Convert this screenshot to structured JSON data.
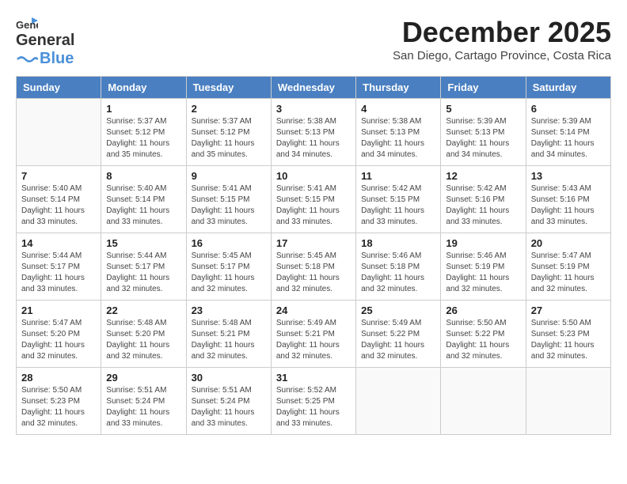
{
  "header": {
    "logo_general": "General",
    "logo_blue": "Blue",
    "month_title": "December 2025",
    "subtitle": "San Diego, Cartago Province, Costa Rica"
  },
  "weekdays": [
    "Sunday",
    "Monday",
    "Tuesday",
    "Wednesday",
    "Thursday",
    "Friday",
    "Saturday"
  ],
  "weeks": [
    [
      {
        "day": "",
        "info": ""
      },
      {
        "day": "1",
        "info": "Sunrise: 5:37 AM\nSunset: 5:12 PM\nDaylight: 11 hours\nand 35 minutes."
      },
      {
        "day": "2",
        "info": "Sunrise: 5:37 AM\nSunset: 5:12 PM\nDaylight: 11 hours\nand 35 minutes."
      },
      {
        "day": "3",
        "info": "Sunrise: 5:38 AM\nSunset: 5:13 PM\nDaylight: 11 hours\nand 34 minutes."
      },
      {
        "day": "4",
        "info": "Sunrise: 5:38 AM\nSunset: 5:13 PM\nDaylight: 11 hours\nand 34 minutes."
      },
      {
        "day": "5",
        "info": "Sunrise: 5:39 AM\nSunset: 5:13 PM\nDaylight: 11 hours\nand 34 minutes."
      },
      {
        "day": "6",
        "info": "Sunrise: 5:39 AM\nSunset: 5:14 PM\nDaylight: 11 hours\nand 34 minutes."
      }
    ],
    [
      {
        "day": "7",
        "info": "Sunrise: 5:40 AM\nSunset: 5:14 PM\nDaylight: 11 hours\nand 33 minutes."
      },
      {
        "day": "8",
        "info": "Sunrise: 5:40 AM\nSunset: 5:14 PM\nDaylight: 11 hours\nand 33 minutes."
      },
      {
        "day": "9",
        "info": "Sunrise: 5:41 AM\nSunset: 5:15 PM\nDaylight: 11 hours\nand 33 minutes."
      },
      {
        "day": "10",
        "info": "Sunrise: 5:41 AM\nSunset: 5:15 PM\nDaylight: 11 hours\nand 33 minutes."
      },
      {
        "day": "11",
        "info": "Sunrise: 5:42 AM\nSunset: 5:15 PM\nDaylight: 11 hours\nand 33 minutes."
      },
      {
        "day": "12",
        "info": "Sunrise: 5:42 AM\nSunset: 5:16 PM\nDaylight: 11 hours\nand 33 minutes."
      },
      {
        "day": "13",
        "info": "Sunrise: 5:43 AM\nSunset: 5:16 PM\nDaylight: 11 hours\nand 33 minutes."
      }
    ],
    [
      {
        "day": "14",
        "info": "Sunrise: 5:44 AM\nSunset: 5:17 PM\nDaylight: 11 hours\nand 33 minutes."
      },
      {
        "day": "15",
        "info": "Sunrise: 5:44 AM\nSunset: 5:17 PM\nDaylight: 11 hours\nand 32 minutes."
      },
      {
        "day": "16",
        "info": "Sunrise: 5:45 AM\nSunset: 5:17 PM\nDaylight: 11 hours\nand 32 minutes."
      },
      {
        "day": "17",
        "info": "Sunrise: 5:45 AM\nSunset: 5:18 PM\nDaylight: 11 hours\nand 32 minutes."
      },
      {
        "day": "18",
        "info": "Sunrise: 5:46 AM\nSunset: 5:18 PM\nDaylight: 11 hours\nand 32 minutes."
      },
      {
        "day": "19",
        "info": "Sunrise: 5:46 AM\nSunset: 5:19 PM\nDaylight: 11 hours\nand 32 minutes."
      },
      {
        "day": "20",
        "info": "Sunrise: 5:47 AM\nSunset: 5:19 PM\nDaylight: 11 hours\nand 32 minutes."
      }
    ],
    [
      {
        "day": "21",
        "info": "Sunrise: 5:47 AM\nSunset: 5:20 PM\nDaylight: 11 hours\nand 32 minutes."
      },
      {
        "day": "22",
        "info": "Sunrise: 5:48 AM\nSunset: 5:20 PM\nDaylight: 11 hours\nand 32 minutes."
      },
      {
        "day": "23",
        "info": "Sunrise: 5:48 AM\nSunset: 5:21 PM\nDaylight: 11 hours\nand 32 minutes."
      },
      {
        "day": "24",
        "info": "Sunrise: 5:49 AM\nSunset: 5:21 PM\nDaylight: 11 hours\nand 32 minutes."
      },
      {
        "day": "25",
        "info": "Sunrise: 5:49 AM\nSunset: 5:22 PM\nDaylight: 11 hours\nand 32 minutes."
      },
      {
        "day": "26",
        "info": "Sunrise: 5:50 AM\nSunset: 5:22 PM\nDaylight: 11 hours\nand 32 minutes."
      },
      {
        "day": "27",
        "info": "Sunrise: 5:50 AM\nSunset: 5:23 PM\nDaylight: 11 hours\nand 32 minutes."
      }
    ],
    [
      {
        "day": "28",
        "info": "Sunrise: 5:50 AM\nSunset: 5:23 PM\nDaylight: 11 hours\nand 32 minutes."
      },
      {
        "day": "29",
        "info": "Sunrise: 5:51 AM\nSunset: 5:24 PM\nDaylight: 11 hours\nand 33 minutes."
      },
      {
        "day": "30",
        "info": "Sunrise: 5:51 AM\nSunset: 5:24 PM\nDaylight: 11 hours\nand 33 minutes."
      },
      {
        "day": "31",
        "info": "Sunrise: 5:52 AM\nSunset: 5:25 PM\nDaylight: 11 hours\nand 33 minutes."
      },
      {
        "day": "",
        "info": ""
      },
      {
        "day": "",
        "info": ""
      },
      {
        "day": "",
        "info": ""
      }
    ]
  ]
}
